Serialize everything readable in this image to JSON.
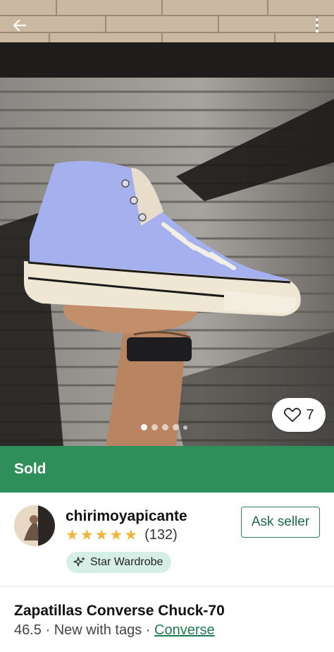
{
  "header": {
    "back_icon": "arrow-left-icon",
    "more_icon": "more-vertical-icon"
  },
  "photo": {
    "favorite_icon": "heart-icon",
    "favorite_count": "7",
    "image_count": 5,
    "active_index": 0
  },
  "status": {
    "label": "Sold",
    "color": "#2f8f5b"
  },
  "seller": {
    "username": "chirimoyapicante",
    "rating_stars": 5,
    "review_count": "(132)",
    "badge_label": "Star Wardrobe",
    "badge_icon": "sparkle-icon",
    "ask_button_label": "Ask seller"
  },
  "item": {
    "title": "Zapatillas Converse Chuck-70",
    "size": "46.5",
    "separator": "·",
    "condition": "New with tags",
    "brand": "Converse"
  },
  "colors": {
    "accent": "#2f7d5a",
    "star": "#f0b43a",
    "badge_bg": "#d5efe6"
  }
}
